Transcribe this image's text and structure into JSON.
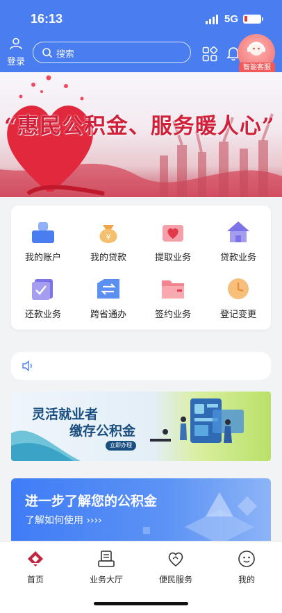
{
  "status_bar": {
    "time": "16:13",
    "network": "5G"
  },
  "header": {
    "login_label": "登录",
    "search_placeholder": "搜索",
    "service_label": "智能客服"
  },
  "banner": {
    "title": "“惠民公积金、服务暖人心”"
  },
  "functions": [
    {
      "label": "我的账户",
      "icon": "account-icon"
    },
    {
      "label": "我的贷款",
      "icon": "loan-bag-icon"
    },
    {
      "label": "提取业务",
      "icon": "withdraw-heart-icon"
    },
    {
      "label": "贷款业务",
      "icon": "house-icon"
    },
    {
      "label": "还款业务",
      "icon": "repay-check-icon"
    },
    {
      "label": "跨省通办",
      "icon": "transfer-arrows-icon"
    },
    {
      "label": "签约业务",
      "icon": "folder-icon"
    },
    {
      "label": "登记变更",
      "icon": "clock-icon"
    }
  ],
  "ad_flexible": {
    "line1": "灵活就业者",
    "line2": "缴存公积金",
    "button": "立即办理"
  },
  "ad_learn": {
    "title": "进一步了解您的公积金",
    "subtitle": "了解如何使用 ››››"
  },
  "tabbar": [
    {
      "label": "首页",
      "icon": "home-logo-icon"
    },
    {
      "label": "业务大厅",
      "icon": "business-hall-icon"
    },
    {
      "label": "便民服务",
      "icon": "heart-service-icon"
    },
    {
      "label": "我的",
      "icon": "profile-face-icon"
    }
  ],
  "colors": {
    "primary": "#4a7df0",
    "accent_red": "#d1203a",
    "service_bg": "#f06b6b"
  }
}
